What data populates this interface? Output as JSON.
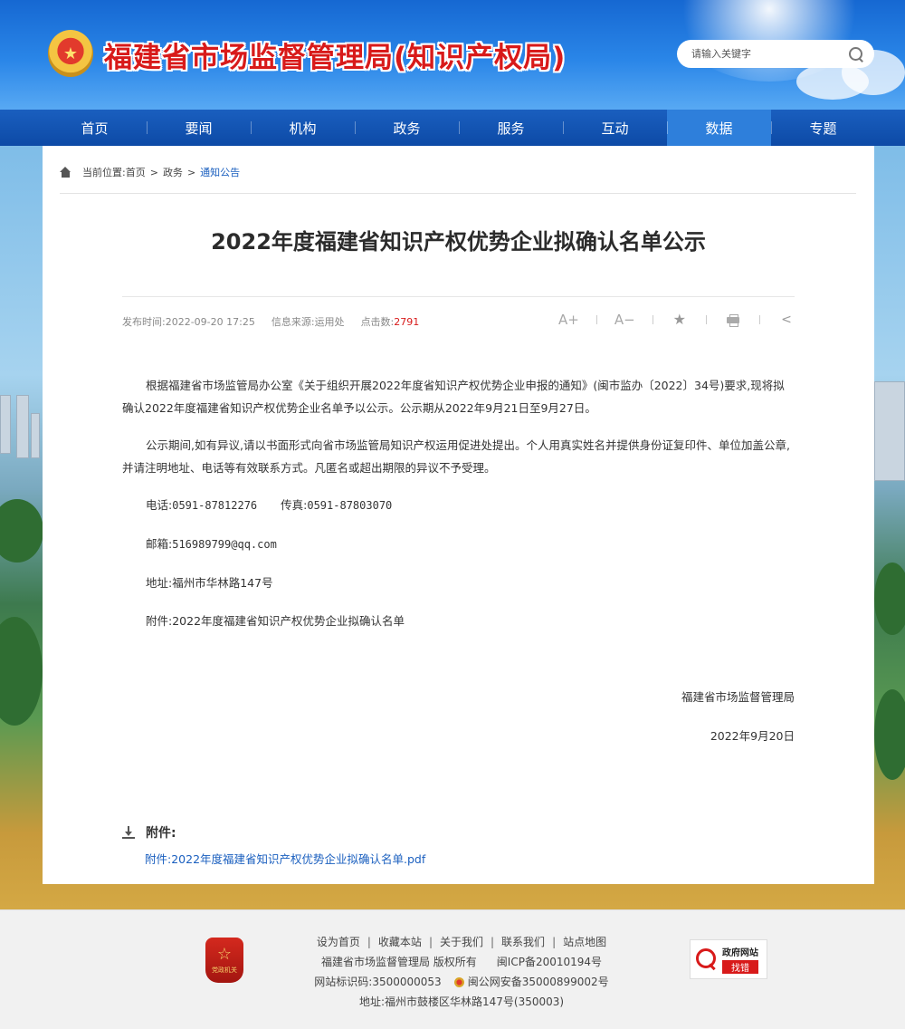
{
  "header": {
    "site_title": "福建省市场监督管理局(知识产权局)",
    "search_placeholder": "请输入关键字"
  },
  "nav": {
    "items": [
      {
        "label": "首页"
      },
      {
        "label": "要闻"
      },
      {
        "label": "机构"
      },
      {
        "label": "政务"
      },
      {
        "label": "服务"
      },
      {
        "label": "互动"
      },
      {
        "label": "数据",
        "active": true
      },
      {
        "label": "专题"
      }
    ]
  },
  "breadcrumb": {
    "prefix": "当前位置:",
    "items": [
      "首页",
      "政务",
      "通知公告"
    ],
    "separator": ">"
  },
  "article": {
    "title": "2022年度福建省知识产权优势企业拟确认名单公示",
    "publish_label": "发布时间:",
    "publish_time": "2022-09-20 17:25",
    "source_label": "信息来源:",
    "source": "运用处",
    "hits_label": "点击数:",
    "hits": "2791",
    "tools": {
      "font_larger": "A+",
      "font_smaller": "A−"
    },
    "paragraphs": [
      "根据福建省市场监管局办公室《关于组织开展2022年度省知识产权优势企业申报的通知》(闽市监办〔2022〕34号)要求,现将拟确认2022年度福建省知识产权优势企业名单予以公示。公示期从2022年9月21日至9月27日。",
      "公示期间,如有异议,请以书面形式向省市场监管局知识产权运用促进处提出。个人用真实姓名并提供身份证复印件、单位加盖公章,并请注明地址、电话等有效联系方式。凡匿名或超出期限的异议不予受理。"
    ],
    "contact": {
      "phone_label": "电话:",
      "phone": "0591-87812276",
      "fax_label": "传真:",
      "fax": "0591-87803070",
      "email_label": "邮箱:",
      "email": "516989799@qq.com",
      "address_label": "地址:",
      "address": "福州市华林路147号",
      "attachment_label": "附件:",
      "attachment": "2022年度福建省知识产权优势企业拟确认名单"
    },
    "signature_org": "福建省市场监督管理局",
    "signature_date": "2022年9月20日",
    "attachments_heading": "附件:",
    "attachment_link": "附件:2022年度福建省知识产权优势企业拟确认名单.pdf"
  },
  "footer": {
    "links": [
      "设为首页",
      "收藏本站",
      "关于我们",
      "联系我们",
      "站点地图"
    ],
    "copyright": "福建省市场监督管理局 版权所有",
    "icp": "闽ICP备20010194号",
    "site_id": "网站标识码:3500000053",
    "police": "闽公网安备35000899002号",
    "address": "地址:福州市鼓楼区华林路147号(350003)",
    "party_badge_label": "党政机关",
    "gov_badge_line1": "政府网站",
    "gov_badge_line2": "找错"
  }
}
